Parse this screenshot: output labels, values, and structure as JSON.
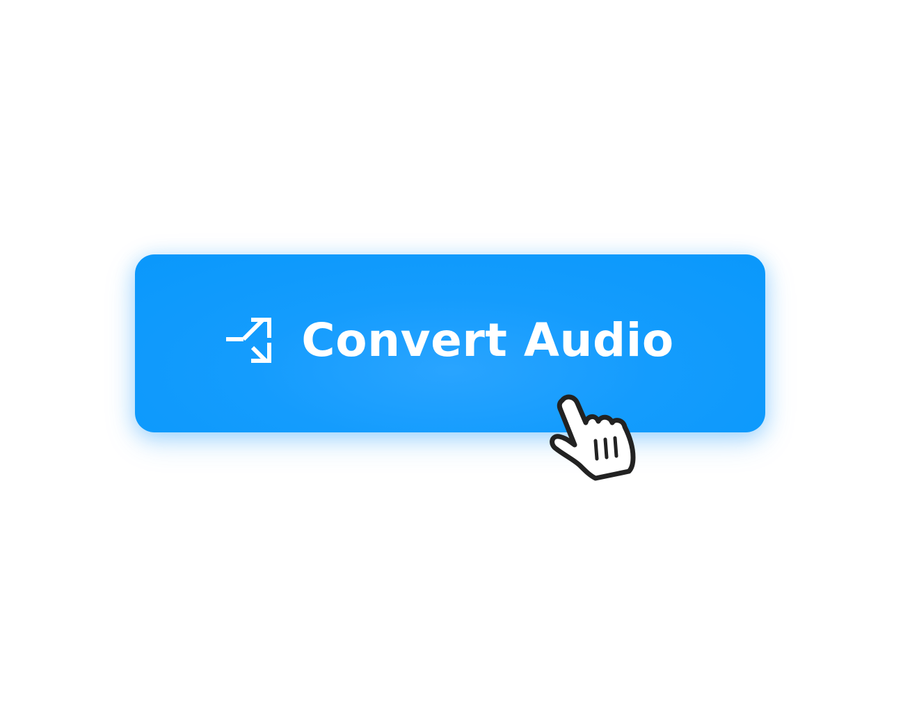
{
  "button": {
    "label": "Convert Audio",
    "icon": "split-arrows-icon",
    "background": "#149cfd",
    "text_color": "#ffffff"
  },
  "cursor": {
    "icon": "hand-pointer-cursor-icon"
  }
}
